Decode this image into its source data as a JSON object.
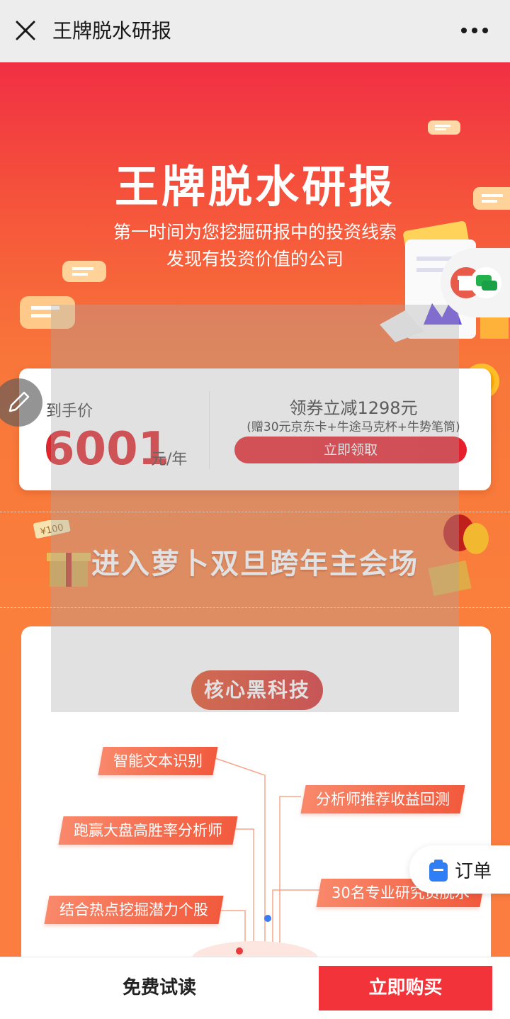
{
  "nav": {
    "title": "王牌脱水研报",
    "close_icon": "close-icon",
    "more_icon": "more-icon"
  },
  "hero": {
    "title": "王牌脱水研报",
    "subtitle_line1": "第一时间为您挖掘研报中的投资线索",
    "subtitle_line2": "发现有投资价值的公司"
  },
  "price_card": {
    "label": "到手价",
    "price": "6001",
    "unit": "元/年",
    "coupon_title": "领券立减1298元",
    "coupon_note": "(赠30元京东卡+牛途马克杯+牛势笔筒)",
    "claim_button": "立即领取"
  },
  "banner": {
    "text": "进入萝卜双旦跨年主会场",
    "badge": "¥100"
  },
  "tech": {
    "pill": "核心黑科技",
    "tags": [
      "智能文本识别",
      "分析师推荐收益回测",
      "跑赢大盘高胜率分析师",
      "结合热点挖掘潜力个股",
      "30名专业研究员脱水"
    ]
  },
  "floating": {
    "order_label": "订单",
    "coin_symbol": "¥"
  },
  "bottom": {
    "free_trial": "免费试读",
    "buy_now": "立即购买"
  },
  "colors": {
    "accent": "#f2333a",
    "price_red": "#e1252c",
    "hero_top": "#f12f44",
    "hero_bottom": "#fb7d40"
  }
}
